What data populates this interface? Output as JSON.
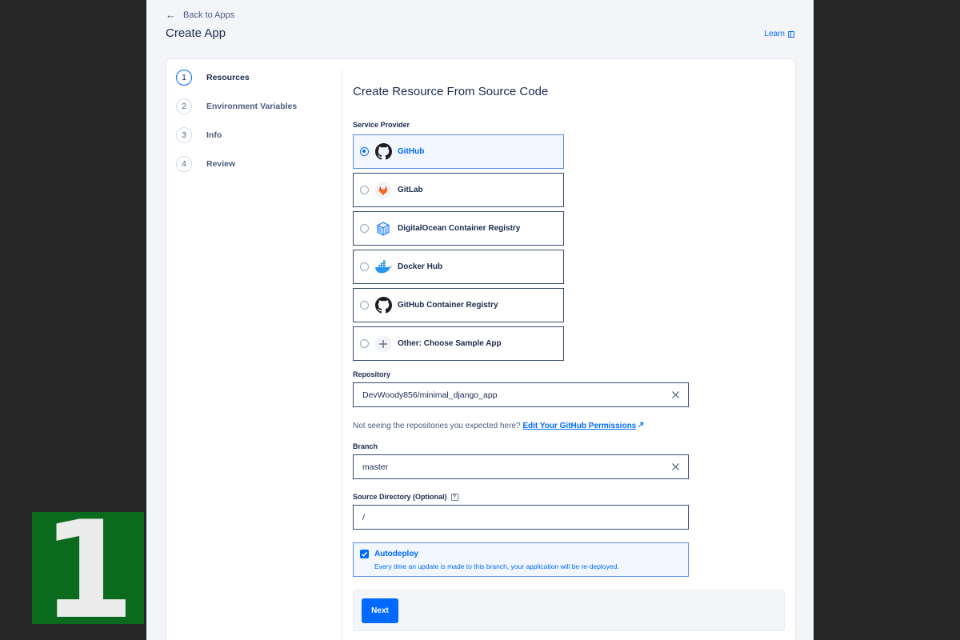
{
  "badge": {
    "number": "1"
  },
  "header": {
    "back_label": "Back to Apps",
    "title": "Create App",
    "learn_label": "Learn"
  },
  "steps": [
    {
      "num": "1",
      "label": "Resources",
      "active": true
    },
    {
      "num": "2",
      "label": "Environment Variables",
      "active": false
    },
    {
      "num": "3",
      "label": "Info",
      "active": false
    },
    {
      "num": "4",
      "label": "Review",
      "active": false
    }
  ],
  "form": {
    "title": "Create Resource From Source Code",
    "service_provider_label": "Service Provider",
    "providers": [
      {
        "label": "GitHub",
        "icon": "github-icon",
        "selected": true
      },
      {
        "label": "GitLab",
        "icon": "gitlab-icon",
        "selected": false
      },
      {
        "label": "DigitalOcean Container Registry",
        "icon": "container-registry-icon",
        "selected": false
      },
      {
        "label": "Docker Hub",
        "icon": "docker-icon",
        "selected": false
      },
      {
        "label": "GitHub Container Registry",
        "icon": "github-icon",
        "selected": false
      },
      {
        "label": "Other: Choose Sample App",
        "icon": "plus-icon",
        "selected": false
      }
    ],
    "repository_label": "Repository",
    "repository_value": "DevWoody856/minimal_django_app",
    "hint_text": "Not seeing the repositories you expected here?",
    "hint_link": "Edit Your GitHub Permissions",
    "branch_label": "Branch",
    "branch_value": "master",
    "source_dir_label": "Source Directory (Optional)",
    "source_dir_help": "?",
    "source_dir_value": "/",
    "autodeploy_title": "Autodeploy",
    "autodeploy_desc": "Every time an update is made to this branch, your application will be re-deployed.",
    "autodeploy_checked": true,
    "next_label": "Next"
  },
  "colors": {
    "accent": "#0069ff",
    "badge_bg": "#0a6b1e",
    "backdrop": "#262626",
    "page_bg": "#f3f5f9"
  }
}
